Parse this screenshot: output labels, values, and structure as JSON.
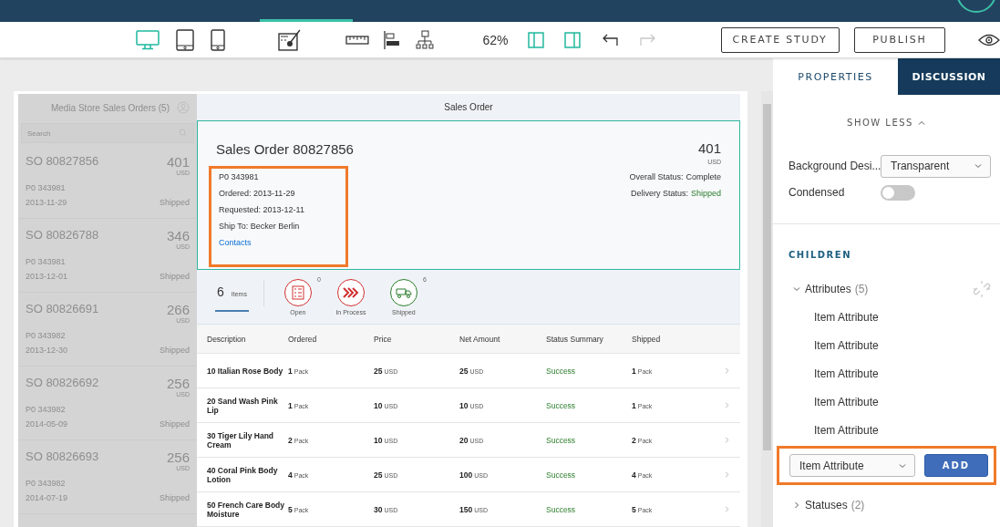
{
  "toolbar": {
    "devices": [
      {
        "kind": "desktop",
        "selected": true
      },
      {
        "kind": "tablet",
        "selected": false
      },
      {
        "kind": "phone",
        "selected": false
      }
    ],
    "zoom": "62%",
    "redo_disabled": true,
    "buttons": [
      "CREATE STUDY",
      "PUBLISH"
    ]
  },
  "master": {
    "title": "Media Store Sales Orders (5)",
    "search": {
      "placeholder": "Search"
    },
    "items": [
      {
        "title": "SO 80827856",
        "amount": "401",
        "currency": "USD",
        "po": "P0 343981",
        "date": "2013-11-29",
        "status": "Shipped"
      },
      {
        "title": "SO 80826788",
        "amount": "346",
        "currency": "USD",
        "po": "P0 343981",
        "date": "2013-12-01",
        "status": "Shipped"
      },
      {
        "title": "SO 80826691",
        "amount": "266",
        "currency": "USD",
        "po": "P0 343982",
        "date": "2013-12-30",
        "status": "Shipped"
      },
      {
        "title": "SO 80826692",
        "amount": "256",
        "currency": "USD",
        "po": "P0 343982",
        "date": "2014-05-09",
        "status": "Shipped"
      },
      {
        "title": "SO 80826693",
        "amount": "256",
        "currency": "USD",
        "po": "P0 343982",
        "date": "2014-07-19",
        "status": "Shipped"
      }
    ]
  },
  "detail": {
    "page_title": "Sales Order",
    "header": {
      "title": "Sales Order 80827856",
      "attributes": [
        "P0 343981",
        "Ordered: 2013-11-29",
        "Requested: 2013-12-11",
        "Ship To: Becker Berlin"
      ],
      "link": "Contacts",
      "amount": "401",
      "currency": "USD",
      "statuses": [
        {
          "label": "Overall Status:",
          "value": "Complete",
          "success": false
        },
        {
          "label": "Delivery Status:",
          "value": "Shipped",
          "success": true
        }
      ]
    },
    "icon_tabs": [
      {
        "kind": "count",
        "count": "6",
        "label": "Items",
        "selected": true
      },
      {
        "kind": "list",
        "label": "Open",
        "count": "0",
        "success": false,
        "selected": false
      },
      {
        "kind": "forward",
        "label": "In Process",
        "success": false,
        "selected": false
      },
      {
        "kind": "truck",
        "label": "Shipped",
        "count": "6",
        "success": true,
        "selected": false
      }
    ],
    "table": {
      "columns": [
        "Description",
        "Ordered",
        "Price",
        "Net Amount",
        "Status Summary",
        "Shipped"
      ],
      "rows": [
        {
          "description": "10 Italian Rose Body",
          "ordered": {
            "qty": "1",
            "unit": "Pack"
          },
          "price": {
            "qty": "25",
            "unit": "USD"
          },
          "net": {
            "qty": "25",
            "unit": "USD"
          },
          "status": "Success",
          "shipped": {
            "qty": "1",
            "unit": "Pack"
          }
        },
        {
          "description": "20 Sand Wash Pink Lip",
          "ordered": {
            "qty": "1",
            "unit": "Pack"
          },
          "price": {
            "qty": "10",
            "unit": "USD"
          },
          "net": {
            "qty": "10",
            "unit": "USD"
          },
          "status": "Success",
          "shipped": {
            "qty": "1",
            "unit": "Pack"
          }
        },
        {
          "description": "30 Tiger Lily Hand Cream",
          "ordered": {
            "qty": "2",
            "unit": "Pack"
          },
          "price": {
            "qty": "10",
            "unit": "USD"
          },
          "net": {
            "qty": "20",
            "unit": "USD"
          },
          "status": "Success",
          "shipped": {
            "qty": "2",
            "unit": "Pack"
          }
        },
        {
          "description": "40 Coral Pink Body Lotion",
          "ordered": {
            "qty": "4",
            "unit": "Pack"
          },
          "price": {
            "qty": "25",
            "unit": "USD"
          },
          "net": {
            "qty": "100",
            "unit": "USD"
          },
          "status": "Success",
          "shipped": {
            "qty": "4",
            "unit": "Pack"
          }
        },
        {
          "description": "50 French Care Body Moisture",
          "ordered": {
            "qty": "5",
            "unit": "Pack"
          },
          "price": {
            "qty": "30",
            "unit": "USD"
          },
          "net": {
            "qty": "150",
            "unit": "USD"
          },
          "status": "Success",
          "shipped": {
            "qty": "5",
            "unit": "Pack"
          }
        }
      ]
    }
  },
  "panel": {
    "tabs": [
      {
        "label": "PROPERTIES",
        "selected": true
      },
      {
        "label": "DISCUSSION",
        "selected": false
      }
    ],
    "show_less": "SHOW LESS",
    "background": {
      "label": "Background Desi...",
      "value": "Transparent"
    },
    "condensed": {
      "label": "Condensed",
      "on": false
    },
    "children_title": "CHILDREN",
    "groups": [
      {
        "name": "Attributes",
        "count": "(5)",
        "expanded": true,
        "children": [
          "Item Attribute",
          "Item Attribute",
          "Item Attribute",
          "Item Attribute",
          "Item Attribute"
        ]
      },
      {
        "name": "Statuses",
        "count": "(2)",
        "expanded": false
      }
    ],
    "add_select": "Item Attribute",
    "add_button": "ADD"
  }
}
